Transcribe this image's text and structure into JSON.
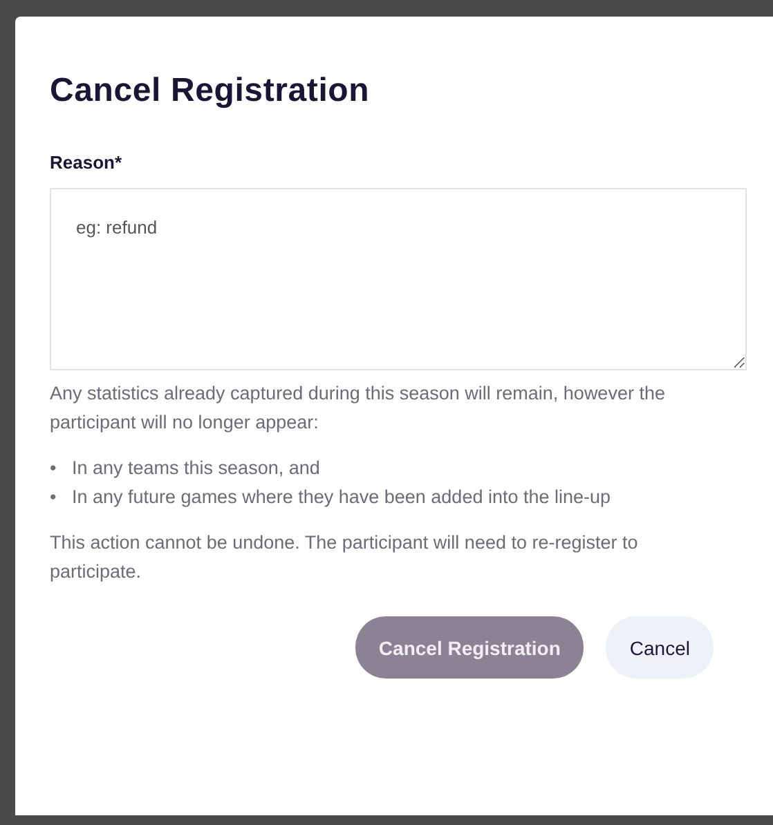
{
  "dialog": {
    "title": "Cancel Registration",
    "reason_field": {
      "label": "Reason*",
      "placeholder": "eg: refund"
    },
    "intro": "Any statistics already captured during this season will remain, however the participant will no longer appear:",
    "bullets": [
      {
        "marker": "•",
        "text": "In any teams this season, and"
      },
      {
        "marker": "•",
        "text": "In any future games where they have been added into the line-up"
      }
    ],
    "warning": "This action cannot be undone. The participant will need to re-register to participate.",
    "buttons": [
      {
        "label": "Cancel Registration",
        "kind": "primary",
        "disabled": true
      },
      {
        "label": "Cancel",
        "kind": "secondary",
        "disabled": false
      }
    ]
  }
}
